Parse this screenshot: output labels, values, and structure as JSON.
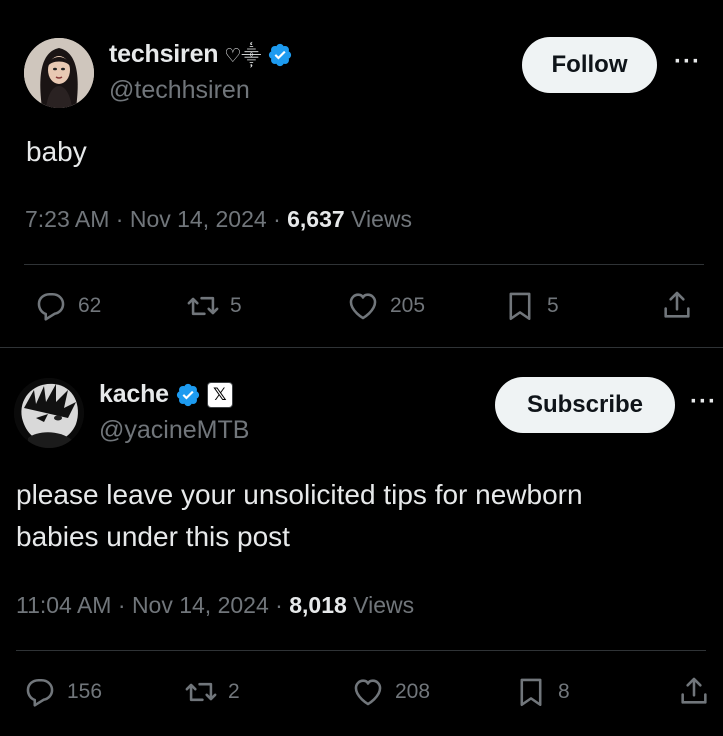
{
  "posts": [
    {
      "display_name": "techsiren",
      "name_emoji": "♡⸎",
      "handle": "@techhsiren",
      "action_button": "Follow",
      "text": "baby",
      "time": "7:23 AM",
      "date": "Nov 14, 2024",
      "views_count": "6,637",
      "views_label": "Views",
      "replies": "62",
      "reposts": "5",
      "likes": "205",
      "bookmarks": "5"
    },
    {
      "display_name": "kache",
      "affiliate_badge": "𝕏",
      "handle": "@yacineMTB",
      "action_button": "Subscribe",
      "text_line1": "please leave your unsolicited tips for newborn",
      "text_line2": "babies under this post",
      "time": "11:04 AM",
      "date": "Nov 14, 2024",
      "views_count": "8,018",
      "views_label": "Views",
      "replies": "156",
      "reposts": "2",
      "likes": "208",
      "bookmarks": "8"
    }
  ],
  "more_icon": "···",
  "separator": "·",
  "colors": {
    "background": "#000000",
    "verified": "#1d9bf0",
    "muted": "#71767b",
    "text": "#e7e9ea"
  }
}
